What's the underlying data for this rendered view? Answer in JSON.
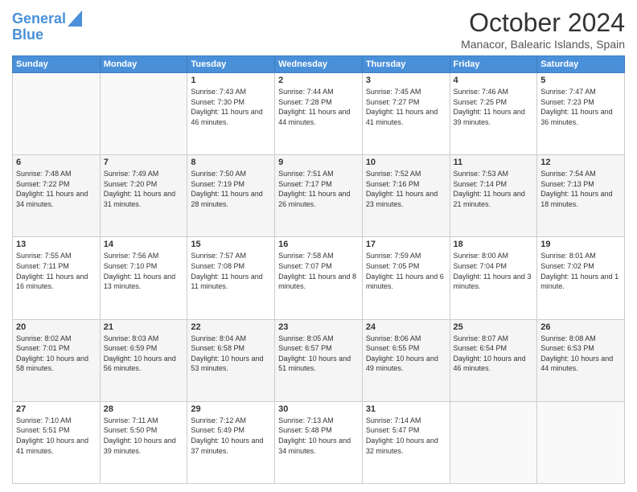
{
  "header": {
    "logo_line1": "General",
    "logo_line2": "Blue",
    "month": "October 2024",
    "location": "Manacor, Balearic Islands, Spain"
  },
  "days_of_week": [
    "Sunday",
    "Monday",
    "Tuesday",
    "Wednesday",
    "Thursday",
    "Friday",
    "Saturday"
  ],
  "weeks": [
    [
      {
        "day": "",
        "sunrise": "",
        "sunset": "",
        "daylight": ""
      },
      {
        "day": "",
        "sunrise": "",
        "sunset": "",
        "daylight": ""
      },
      {
        "day": "1",
        "sunrise": "Sunrise: 7:43 AM",
        "sunset": "Sunset: 7:30 PM",
        "daylight": "Daylight: 11 hours and 46 minutes."
      },
      {
        "day": "2",
        "sunrise": "Sunrise: 7:44 AM",
        "sunset": "Sunset: 7:28 PM",
        "daylight": "Daylight: 11 hours and 44 minutes."
      },
      {
        "day": "3",
        "sunrise": "Sunrise: 7:45 AM",
        "sunset": "Sunset: 7:27 PM",
        "daylight": "Daylight: 11 hours and 41 minutes."
      },
      {
        "day": "4",
        "sunrise": "Sunrise: 7:46 AM",
        "sunset": "Sunset: 7:25 PM",
        "daylight": "Daylight: 11 hours and 39 minutes."
      },
      {
        "day": "5",
        "sunrise": "Sunrise: 7:47 AM",
        "sunset": "Sunset: 7:23 PM",
        "daylight": "Daylight: 11 hours and 36 minutes."
      }
    ],
    [
      {
        "day": "6",
        "sunrise": "Sunrise: 7:48 AM",
        "sunset": "Sunset: 7:22 PM",
        "daylight": "Daylight: 11 hours and 34 minutes."
      },
      {
        "day": "7",
        "sunrise": "Sunrise: 7:49 AM",
        "sunset": "Sunset: 7:20 PM",
        "daylight": "Daylight: 11 hours and 31 minutes."
      },
      {
        "day": "8",
        "sunrise": "Sunrise: 7:50 AM",
        "sunset": "Sunset: 7:19 PM",
        "daylight": "Daylight: 11 hours and 28 minutes."
      },
      {
        "day": "9",
        "sunrise": "Sunrise: 7:51 AM",
        "sunset": "Sunset: 7:17 PM",
        "daylight": "Daylight: 11 hours and 26 minutes."
      },
      {
        "day": "10",
        "sunrise": "Sunrise: 7:52 AM",
        "sunset": "Sunset: 7:16 PM",
        "daylight": "Daylight: 11 hours and 23 minutes."
      },
      {
        "day": "11",
        "sunrise": "Sunrise: 7:53 AM",
        "sunset": "Sunset: 7:14 PM",
        "daylight": "Daylight: 11 hours and 21 minutes."
      },
      {
        "day": "12",
        "sunrise": "Sunrise: 7:54 AM",
        "sunset": "Sunset: 7:13 PM",
        "daylight": "Daylight: 11 hours and 18 minutes."
      }
    ],
    [
      {
        "day": "13",
        "sunrise": "Sunrise: 7:55 AM",
        "sunset": "Sunset: 7:11 PM",
        "daylight": "Daylight: 11 hours and 16 minutes."
      },
      {
        "day": "14",
        "sunrise": "Sunrise: 7:56 AM",
        "sunset": "Sunset: 7:10 PM",
        "daylight": "Daylight: 11 hours and 13 minutes."
      },
      {
        "day": "15",
        "sunrise": "Sunrise: 7:57 AM",
        "sunset": "Sunset: 7:08 PM",
        "daylight": "Daylight: 11 hours and 11 minutes."
      },
      {
        "day": "16",
        "sunrise": "Sunrise: 7:58 AM",
        "sunset": "Sunset: 7:07 PM",
        "daylight": "Daylight: 11 hours and 8 minutes."
      },
      {
        "day": "17",
        "sunrise": "Sunrise: 7:59 AM",
        "sunset": "Sunset: 7:05 PM",
        "daylight": "Daylight: 11 hours and 6 minutes."
      },
      {
        "day": "18",
        "sunrise": "Sunrise: 8:00 AM",
        "sunset": "Sunset: 7:04 PM",
        "daylight": "Daylight: 11 hours and 3 minutes."
      },
      {
        "day": "19",
        "sunrise": "Sunrise: 8:01 AM",
        "sunset": "Sunset: 7:02 PM",
        "daylight": "Daylight: 11 hours and 1 minute."
      }
    ],
    [
      {
        "day": "20",
        "sunrise": "Sunrise: 8:02 AM",
        "sunset": "Sunset: 7:01 PM",
        "daylight": "Daylight: 10 hours and 58 minutes."
      },
      {
        "day": "21",
        "sunrise": "Sunrise: 8:03 AM",
        "sunset": "Sunset: 6:59 PM",
        "daylight": "Daylight: 10 hours and 56 minutes."
      },
      {
        "day": "22",
        "sunrise": "Sunrise: 8:04 AM",
        "sunset": "Sunset: 6:58 PM",
        "daylight": "Daylight: 10 hours and 53 minutes."
      },
      {
        "day": "23",
        "sunrise": "Sunrise: 8:05 AM",
        "sunset": "Sunset: 6:57 PM",
        "daylight": "Daylight: 10 hours and 51 minutes."
      },
      {
        "day": "24",
        "sunrise": "Sunrise: 8:06 AM",
        "sunset": "Sunset: 6:55 PM",
        "daylight": "Daylight: 10 hours and 49 minutes."
      },
      {
        "day": "25",
        "sunrise": "Sunrise: 8:07 AM",
        "sunset": "Sunset: 6:54 PM",
        "daylight": "Daylight: 10 hours and 46 minutes."
      },
      {
        "day": "26",
        "sunrise": "Sunrise: 8:08 AM",
        "sunset": "Sunset: 6:53 PM",
        "daylight": "Daylight: 10 hours and 44 minutes."
      }
    ],
    [
      {
        "day": "27",
        "sunrise": "Sunrise: 7:10 AM",
        "sunset": "Sunset: 5:51 PM",
        "daylight": "Daylight: 10 hours and 41 minutes."
      },
      {
        "day": "28",
        "sunrise": "Sunrise: 7:11 AM",
        "sunset": "Sunset: 5:50 PM",
        "daylight": "Daylight: 10 hours and 39 minutes."
      },
      {
        "day": "29",
        "sunrise": "Sunrise: 7:12 AM",
        "sunset": "Sunset: 5:49 PM",
        "daylight": "Daylight: 10 hours and 37 minutes."
      },
      {
        "day": "30",
        "sunrise": "Sunrise: 7:13 AM",
        "sunset": "Sunset: 5:48 PM",
        "daylight": "Daylight: 10 hours and 34 minutes."
      },
      {
        "day": "31",
        "sunrise": "Sunrise: 7:14 AM",
        "sunset": "Sunset: 5:47 PM",
        "daylight": "Daylight: 10 hours and 32 minutes."
      },
      {
        "day": "",
        "sunrise": "",
        "sunset": "",
        "daylight": ""
      },
      {
        "day": "",
        "sunrise": "",
        "sunset": "",
        "daylight": ""
      }
    ]
  ],
  "row_shading": [
    false,
    true,
    false,
    true,
    false
  ]
}
